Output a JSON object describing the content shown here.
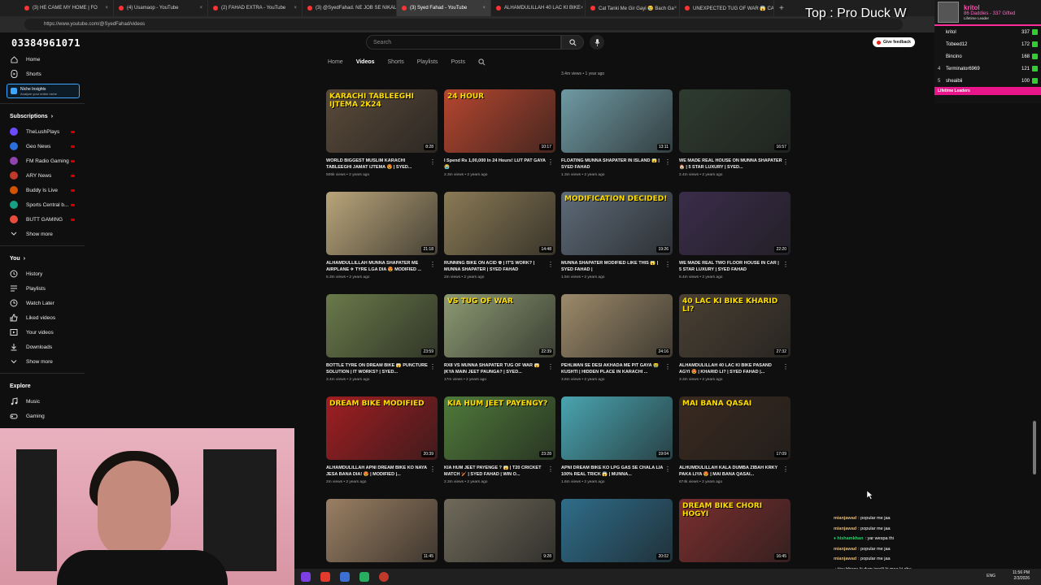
{
  "browser": {
    "tabs": [
      {
        "label": "(3) HE CAME MY HOME | FO",
        "color": "#ff3333"
      },
      {
        "label": "(4) Usamaop - YouTube",
        "color": "#ff3333"
      },
      {
        "label": "(2) FAHAD EXTRA - YouTube",
        "color": "#ff3333"
      },
      {
        "label": "(3) @SyedFahad. NE JOB SE NIKAL",
        "color": "#ff3333"
      },
      {
        "label": "(3) Syed Fahad - YouTube",
        "color": "#ff3333"
      },
      {
        "label": "ALHAMDULILLAH 40 LAC KI BIKE",
        "color": "#ff3333"
      },
      {
        "label": "Cat Tanki Me Gir Gayi 😢 Bach Ga",
        "color": "#ff3333"
      },
      {
        "label": "UNEXPECTED TUG OF WAR 😱 CA",
        "color": "#ff3333"
      }
    ],
    "url": "https://www.youtube.com/@SyedFahad/videos"
  },
  "overlay": {
    "phone": "03384961071",
    "top_label": "Top : Pro Duck W"
  },
  "youtube": {
    "search_placeholder": "Search",
    "feedback": "Give feedback",
    "channel_tabs": [
      "Home",
      "Videos",
      "Shorts",
      "Playlists",
      "Posts"
    ],
    "top_meta": "3.4m views • 1 year ago"
  },
  "sidebar": {
    "main": [
      {
        "label": "Home",
        "icon": "home-icon"
      },
      {
        "label": "Shorts",
        "icon": "shorts-icon"
      }
    ],
    "niche_title": "Niche Insights",
    "niche_sub": "Analyze your entire niche",
    "subscriptions_title": "Subscriptions",
    "subscriptions": [
      {
        "label": "TheLushPlays",
        "color": "#6d4aff"
      },
      {
        "label": "Geo News",
        "color": "#2a6fdb"
      },
      {
        "label": "FM Radio Gaming",
        "color": "#8e44ad"
      },
      {
        "label": "ARY News",
        "color": "#c0392b"
      },
      {
        "label": "Buddy Is Live",
        "color": "#d35400"
      },
      {
        "label": "Sports Central b...",
        "color": "#16a085"
      },
      {
        "label": "BUTT GAMING",
        "color": "#e74c3c"
      }
    ],
    "show_more": "Show more",
    "you_title": "You",
    "you_items": [
      {
        "label": "History",
        "icon": "history-icon"
      },
      {
        "label": "Playlists",
        "icon": "playlists-icon"
      },
      {
        "label": "Watch Later",
        "icon": "watch-later-icon"
      },
      {
        "label": "Liked videos",
        "icon": "like-icon"
      },
      {
        "label": "Your videos",
        "icon": "your-videos-icon"
      },
      {
        "label": "Downloads",
        "icon": "download-icon"
      },
      {
        "label": "Show more",
        "icon": "chevron-down-icon"
      }
    ],
    "explore_title": "Explore",
    "explore_items": [
      {
        "label": "Music",
        "icon": "music-icon"
      },
      {
        "label": "Gaming",
        "icon": "gaming-icon"
      }
    ]
  },
  "videos": [
    {
      "title": "WORLD BIGGEST MUSLIM KARACHI TABLEEGHI JAMAT IJTEMA 😍 | SYED...",
      "meta": "505k views • 2 years ago",
      "duration": "8:28",
      "thumb_text": "KARACHI TABLEEGHI IJTEMA 2K24",
      "bg": "#5a4a3a"
    },
    {
      "title": "I Spend Rs 1,00,000 In 24 Hours! LUT PAT GAYA 😭",
      "meta": "2.3m views • 2 years ago",
      "duration": "10:17",
      "thumb_text": "24 HOUR",
      "bg": "#b5462f"
    },
    {
      "title": "FLOATING MUNNA SHAPATER IN ISLAND 😱 | SYED FAHAD",
      "meta": "1.3m views • 2 years ago",
      "duration": "13:11",
      "thumb_text": "",
      "bg": "#6f9aa3"
    },
    {
      "title": "WE MADE REAL HOUSE ON MUNNA SHAPATER 🏠 | 5 STAR LUXURY | SYED...",
      "meta": "2.4m views • 2 years ago",
      "duration": "16:57",
      "thumb_text": "",
      "bg": "#2e3b2f"
    },
    {
      "title": "ALHAMDULLILLAH MUNNA SHAPATER ME AIRPLANE ✈ TYRE LGA DIA 😍 MODIFIED ...",
      "meta": "6.3m views • 2 years ago",
      "duration": "21:18",
      "thumb_text": "",
      "bg": "#b9a57a"
    },
    {
      "title": "RUNNING BIKE ON ACID ☢ | IT'S WORK? | MUNNA SHAPATER | SYED FAHAD",
      "meta": "2m views • 2 years ago",
      "duration": "14:48",
      "thumb_text": "",
      "bg": "#8a7a55"
    },
    {
      "title": "MUNNA SHAPATER MODIFIED LIKE THIS 😱 | SYED FAHAD |",
      "meta": "1.5m views • 2 years ago",
      "duration": "19:26",
      "thumb_text": "MODIFICATION DECIDED!",
      "bg": "#5d6a78"
    },
    {
      "title": "WE MADE REAL TWO FLOOR HOUSE IN CAR | 5 STAR LUXURY | SYED FAHAD",
      "meta": "6.4m views • 2 years ago",
      "duration": "22:20",
      "thumb_text": "",
      "bg": "#3a2d4a"
    },
    {
      "title": "BOTTLE TYRE ON DREAM BIKE 😱 PUNCTURE SOLUTION | IT WORKS? | SYED...",
      "meta": "3.4m views • 2 years ago",
      "duration": "23:59",
      "thumb_text": "",
      "bg": "#6a7a4a"
    },
    {
      "title": "RX8 VS MUNNA SHAPATER TUG OF WAR 😱 |KYA MAIN JEET PAUNGA? | SYED...",
      "meta": "17m views • 2 years ago",
      "duration": "22:39",
      "thumb_text": "VS TUG OF WAR",
      "bg": "#8d9a73"
    },
    {
      "title": "PEHLWAN SE DESI AKHADA ME PIT GAYA 😭 KUSHTI | HIDDEN PLACE IN KARACHI ...",
      "meta": "3.6m views • 2 years ago",
      "duration": "24:16",
      "thumb_text": "",
      "bg": "#9c8a6a"
    },
    {
      "title": "ALHAMDULILLAH 40 LAC KI BIKE PASAND AGYI 😍 | KHARID LI? | SYED FAHAD |...",
      "meta": "3.3m views • 2 years ago",
      "duration": "27:32",
      "thumb_text": "40 LAC KI BIKE KHARID LI?",
      "bg": "#4a4033"
    },
    {
      "title": "ALHAMDULILLAH APNI DREAM BIKE KO NAYA JESA BANA DIA! 😍 | MODIFIED |...",
      "meta": "2m views • 2 years ago",
      "duration": "20:39",
      "thumb_text": "DREAM BIKE MODIFIED",
      "bg": "#a01e22"
    },
    {
      "title": "KIA HUM JEET PAYENGE ? 😱 | T20 CRICKET MATCH 🏏 | SYED FAHAD | WIN O...",
      "meta": "2.3m views • 2 years ago",
      "duration": "23:28",
      "thumb_text": "KIA HUM JEET PAYENGY?",
      "bg": "#4f7a3a"
    },
    {
      "title": "APNI DREAM BIKE KO LPG GAS SE CHALA LIA 100% REAL TRICK 😱 | MUNNA...",
      "meta": "1.6m views • 2 years ago",
      "duration": "19:04",
      "thumb_text": "",
      "bg": "#4aa4b0"
    },
    {
      "title": "ALHUMDULILLAH KALA DUMBA ZIBAH KRKY PAKA LIYA 😍 | MAI BANA QASAI...",
      "meta": "674k views • 2 years ago",
      "duration": "17:09",
      "thumb_text": "MAI BANA QASAI",
      "bg": "#3a2a20"
    },
    {
      "title": "",
      "meta": "",
      "duration": "11:45",
      "thumb_text": "",
      "bg": "#9a7f63"
    },
    {
      "title": "",
      "meta": "",
      "duration": "9:28",
      "thumb_text": "",
      "bg": "#6f6a5a"
    },
    {
      "title": "",
      "meta": "",
      "duration": "20:02",
      "thumb_text": "",
      "bg": "#2f6d8a"
    },
    {
      "title": "",
      "meta": "",
      "duration": "16:45",
      "thumb_text": "DREAM BIKE CHORI HOGYI",
      "bg": "#7a2e2e"
    }
  ],
  "leaderboard": {
    "name": "kritol",
    "subtitle": "86 Daddies - 337 Gifted",
    "label": "Lifetime Leader",
    "rows": [
      {
        "rank": "",
        "user": "kritol",
        "value": "337"
      },
      {
        "rank": "",
        "user": "Tobeed12",
        "value": "172"
      },
      {
        "rank": "",
        "user": "Bincino",
        "value": "168"
      },
      {
        "rank": "4",
        "user": "Terminator6969",
        "value": "121"
      },
      {
        "rank": "5",
        "user": "sheaibii",
        "value": "100"
      }
    ],
    "footer": "Lifetime Leaders"
  },
  "chat": [
    {
      "user": "mianjawad",
      "msg": ": popular me jaa",
      "color": "#e3b873"
    },
    {
      "user": "mianjawad",
      "msg": ": popular me jaa",
      "color": "#e3b873"
    },
    {
      "user": "hishamkhan",
      "msg": ": yar wespa thi",
      "color": "#22d36a"
    },
    {
      "user": "mianjawad",
      "msg": ": popular me jaa",
      "color": "#e3b873"
    },
    {
      "user": "mianjawad",
      "msg": ": popular me jaa",
      "color": "#e3b873"
    },
    {
      "user": "",
      "msg": ": tjay bhens ki dum israili ki maa ki chu",
      "color": "#e02f2f"
    },
    {
      "user": "",
      "msg": ": tjay bhens ki dum israili ki maa ki chu",
      "color": "#e02f2f"
    }
  ],
  "taskbar": {
    "lang": "ENG",
    "time": "11:56 PM",
    "date": "2/3/2026"
  }
}
